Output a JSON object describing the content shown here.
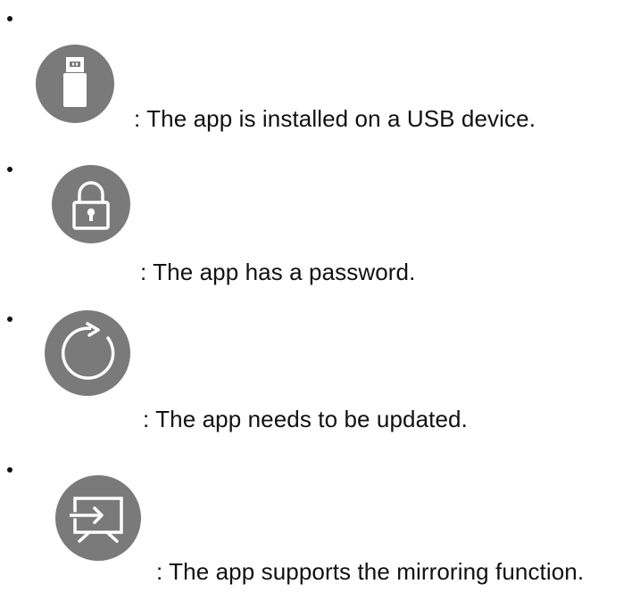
{
  "items": [
    {
      "icon": "usb-icon",
      "text": ": The app is installed on a USB device."
    },
    {
      "icon": "lock-icon",
      "text": ": The app has a password."
    },
    {
      "icon": "refresh-icon",
      "text": ": The app needs to be updated."
    },
    {
      "icon": "mirroring-icon",
      "text": ": The app supports the mirroring function."
    }
  ],
  "colors": {
    "icon_background": "#7a7a7a",
    "icon_foreground": "#ffffff",
    "text": "#111111"
  }
}
